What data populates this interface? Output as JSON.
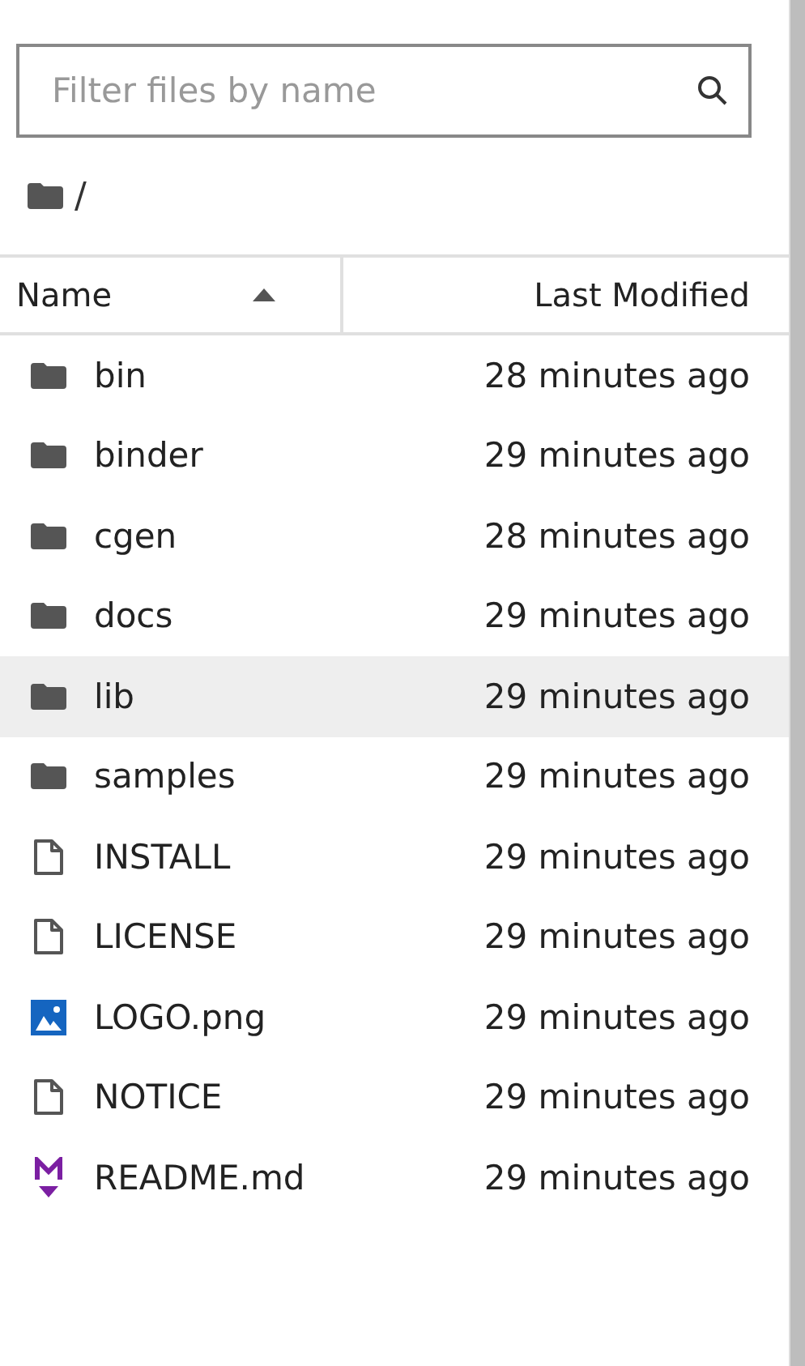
{
  "search": {
    "placeholder": "Filter files by name"
  },
  "breadcrumb": "/",
  "columns": [
    {
      "label": "Name",
      "sorted": true
    },
    {
      "label": "Last Modified",
      "sorted": false
    }
  ],
  "files": [
    {
      "name": "bin",
      "kind": "folder",
      "modified": "28 minutes ago",
      "selected": false
    },
    {
      "name": "binder",
      "kind": "folder",
      "modified": "29 minutes ago",
      "selected": false
    },
    {
      "name": "cgen",
      "kind": "folder",
      "modified": "28 minutes ago",
      "selected": false
    },
    {
      "name": "docs",
      "kind": "folder",
      "modified": "29 minutes ago",
      "selected": false
    },
    {
      "name": "lib",
      "kind": "folder",
      "modified": "29 minutes ago",
      "selected": true
    },
    {
      "name": "samples",
      "kind": "folder",
      "modified": "29 minutes ago",
      "selected": false
    },
    {
      "name": "INSTALL",
      "kind": "file",
      "modified": "29 minutes ago",
      "selected": false
    },
    {
      "name": "LICENSE",
      "kind": "file",
      "modified": "29 minutes ago",
      "selected": false
    },
    {
      "name": "LOGO.png",
      "kind": "image",
      "modified": "29 minutes ago",
      "selected": false
    },
    {
      "name": "NOTICE",
      "kind": "file",
      "modified": "29 minutes ago",
      "selected": false
    },
    {
      "name": "README.md",
      "kind": "markdown",
      "modified": "29 minutes ago",
      "selected": false
    }
  ]
}
